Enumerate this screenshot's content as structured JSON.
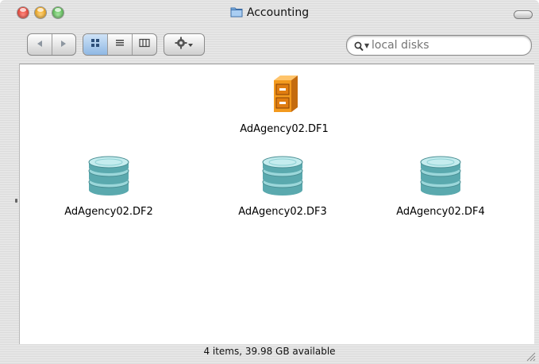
{
  "window": {
    "title": "Accounting"
  },
  "toolbar": {
    "back_icon": "back-arrow-icon",
    "forward_icon": "forward-arrow-icon",
    "views": [
      "icon-view-icon",
      "list-view-icon",
      "column-view-icon"
    ],
    "active_view": "icon-view",
    "action_icon": "gear-icon"
  },
  "search": {
    "placeholder": "local disks",
    "value": ""
  },
  "items": [
    {
      "label": "AdAgency02.DF1",
      "icon": "file-cabinet-icon"
    },
    {
      "label": "AdAgency02.DF2",
      "icon": "disk-stack-icon"
    },
    {
      "label": "AdAgency02.DF3",
      "icon": "disk-stack-icon"
    },
    {
      "label": "AdAgency02.DF4",
      "icon": "disk-stack-icon"
    }
  ],
  "status": {
    "text": "4 items, 39.98 GB available"
  },
  "colors": {
    "accent": "#8fb8e4",
    "disk": "#7cc4c8",
    "cabinet": "#f39a1e"
  }
}
